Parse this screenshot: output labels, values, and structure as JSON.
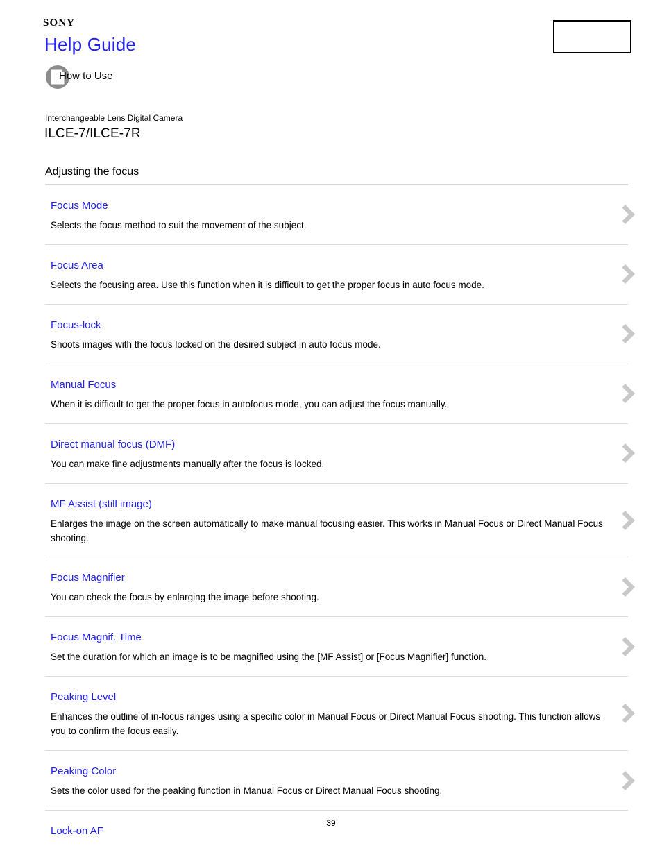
{
  "header": {
    "brand": "SONY",
    "title": "Help Guide",
    "how_to_use_label": "How to Use",
    "how_to_use_icon": "book-page-icon",
    "top_right_box": ""
  },
  "product": {
    "category": "Interchangeable Lens Digital Camera",
    "model": "ILCE-7/ILCE-7R"
  },
  "section": {
    "title": "Adjusting the focus"
  },
  "colors": {
    "link": "#2222ee",
    "text": "#000000",
    "rule": "#dcdcdc",
    "rule_top": "#d8d8d8",
    "chevron": "#c9c9c9",
    "background": "#ffffff"
  },
  "icons": {
    "chevron": "chevron-right-icon"
  },
  "toc": {
    "items": [
      {
        "title": "Focus Mode",
        "desc": "Selects the focus method to suit the movement of the subject."
      },
      {
        "title": "Focus Area",
        "desc": "Selects the focusing area. Use this function when it is difficult to get the proper focus in auto focus mode."
      },
      {
        "title": "Focus-lock",
        "desc": "Shoots images with the focus locked on the desired subject in auto focus mode."
      },
      {
        "title": "Manual Focus",
        "desc": "When it is difficult to get the proper focus in autofocus mode, you can adjust the focus manually."
      },
      {
        "title": "Direct manual focus (DMF)",
        "desc": "You can make fine adjustments manually after the focus is locked."
      },
      {
        "title": "MF Assist (still image)",
        "desc": "Enlarges the image on the screen automatically to make manual focusing easier. This works in Manual Focus or Direct Manual Focus shooting."
      },
      {
        "title": "Focus Magnifier",
        "desc": "You can check the focus by enlarging the image before shooting."
      },
      {
        "title": "Focus Magnif. Time",
        "desc": "Set the duration for which an image is to be magnified using the [MF Assist] or [Focus Magnifier] function."
      },
      {
        "title": "Peaking Level",
        "desc": "Enhances the outline of in-focus ranges using a specific color in Manual Focus or Direct Manual Focus shooting. This function allows you to confirm the focus easily."
      },
      {
        "title": "Peaking Color",
        "desc": "Sets the color used for the peaking function in Manual Focus or Direct Manual Focus shooting."
      },
      {
        "title": "Lock-on AF",
        "desc": ""
      }
    ]
  },
  "footer": {
    "page_number": "39"
  }
}
